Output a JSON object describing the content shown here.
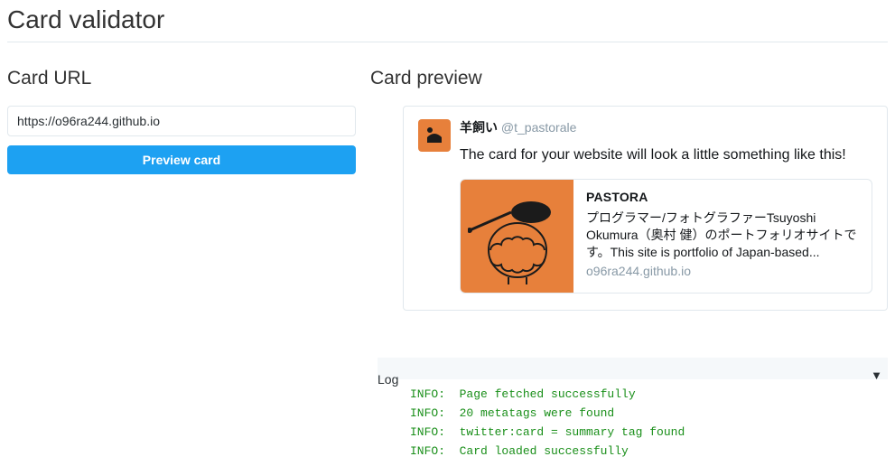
{
  "page": {
    "title": "Card validator"
  },
  "cardUrl": {
    "label": "Card URL",
    "value": "https://o96ra244.github.io",
    "buttonLabel": "Preview card"
  },
  "preview": {
    "label": "Card preview",
    "user": {
      "name": "羊飼い",
      "handle": "@t_pastorale"
    },
    "blurb": "The card for your website will look a little something like this!",
    "card": {
      "title": "PASTORA",
      "description": "プログラマー/フォトグラファーTsuyoshi Okumura（奥村 健）のポートフォリオサイトです。This site is portfolio of Japan-based...",
      "domain": "o96ra244.github.io"
    }
  },
  "log": {
    "label": "Log",
    "lines": [
      "INFO:  Page fetched successfully",
      "INFO:  20 metatags were found",
      "INFO:  twitter:card = summary tag found",
      "INFO:  Card loaded successfully"
    ]
  }
}
